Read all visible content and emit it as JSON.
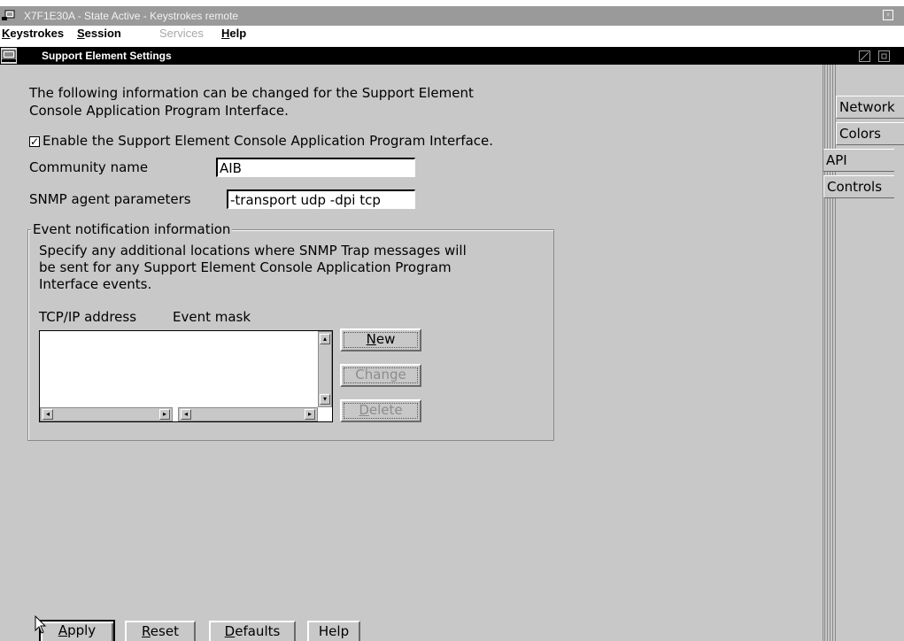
{
  "window": {
    "title": "X7F1E30A - State Active - Keystrokes remote"
  },
  "menu": {
    "items": [
      {
        "label": "Keystrokes",
        "mnemonic": "K",
        "rest": "eystrokes",
        "enabled": true
      },
      {
        "label": "Session",
        "mnemonic": "S",
        "rest": "ession",
        "enabled": true
      },
      {
        "label": "Services",
        "enabled": false
      },
      {
        "label": "Help",
        "mnemonic": "H",
        "rest": "elp",
        "enabled": true
      }
    ]
  },
  "dialog": {
    "title": "Support Element Settings",
    "intro_line1": "The following information can be changed for the Support Element",
    "intro_line2": "Console Application Program Interface.",
    "enable_checkbox": {
      "checked": true,
      "check_glyph": "✓",
      "label": "Enable the Support Element Console Application Program Interface."
    },
    "community": {
      "label": "Community name",
      "value": "AIB"
    },
    "snmp": {
      "label": "SNMP agent parameters",
      "value": "-transport udp -dpi tcp"
    },
    "event_group": {
      "title": "Event notification information",
      "desc_line1": "Specify any additional locations where SNMP Trap messages will",
      "desc_line2": "be sent for any Support Element Console Application Program",
      "desc_line3": "Interface events.",
      "col_tcpip": "TCP/IP address",
      "col_mask": "Event mask",
      "rows": []
    },
    "side_buttons": {
      "new": {
        "label": "New",
        "mnemonic": "N",
        "rest": "ew",
        "enabled": true
      },
      "change": {
        "label": "Change",
        "enabled": false
      },
      "delete": {
        "label": "Delete",
        "mnemonic": "D",
        "rest": "elete",
        "enabled": false
      }
    },
    "bottom_buttons": {
      "apply": {
        "mnemonic": "A",
        "rest": "pply"
      },
      "reset": {
        "mnemonic": "R",
        "rest": "eset"
      },
      "defaults": {
        "mnemonic": "D",
        "rest": "efaults"
      },
      "help": {
        "label": "Help"
      }
    }
  },
  "tabs": [
    {
      "label": "Network",
      "selected": false
    },
    {
      "label": "Colors",
      "selected": false
    },
    {
      "label": "API",
      "selected": true
    },
    {
      "label": "Controls",
      "selected": false
    }
  ],
  "colors": {
    "title_bar": "#9a9a9a",
    "active_titlebar": "#000000",
    "dialog_bg": "#c8c8c8",
    "field_bg": "#ffffff",
    "disabled_text": "#8c8c8c"
  }
}
